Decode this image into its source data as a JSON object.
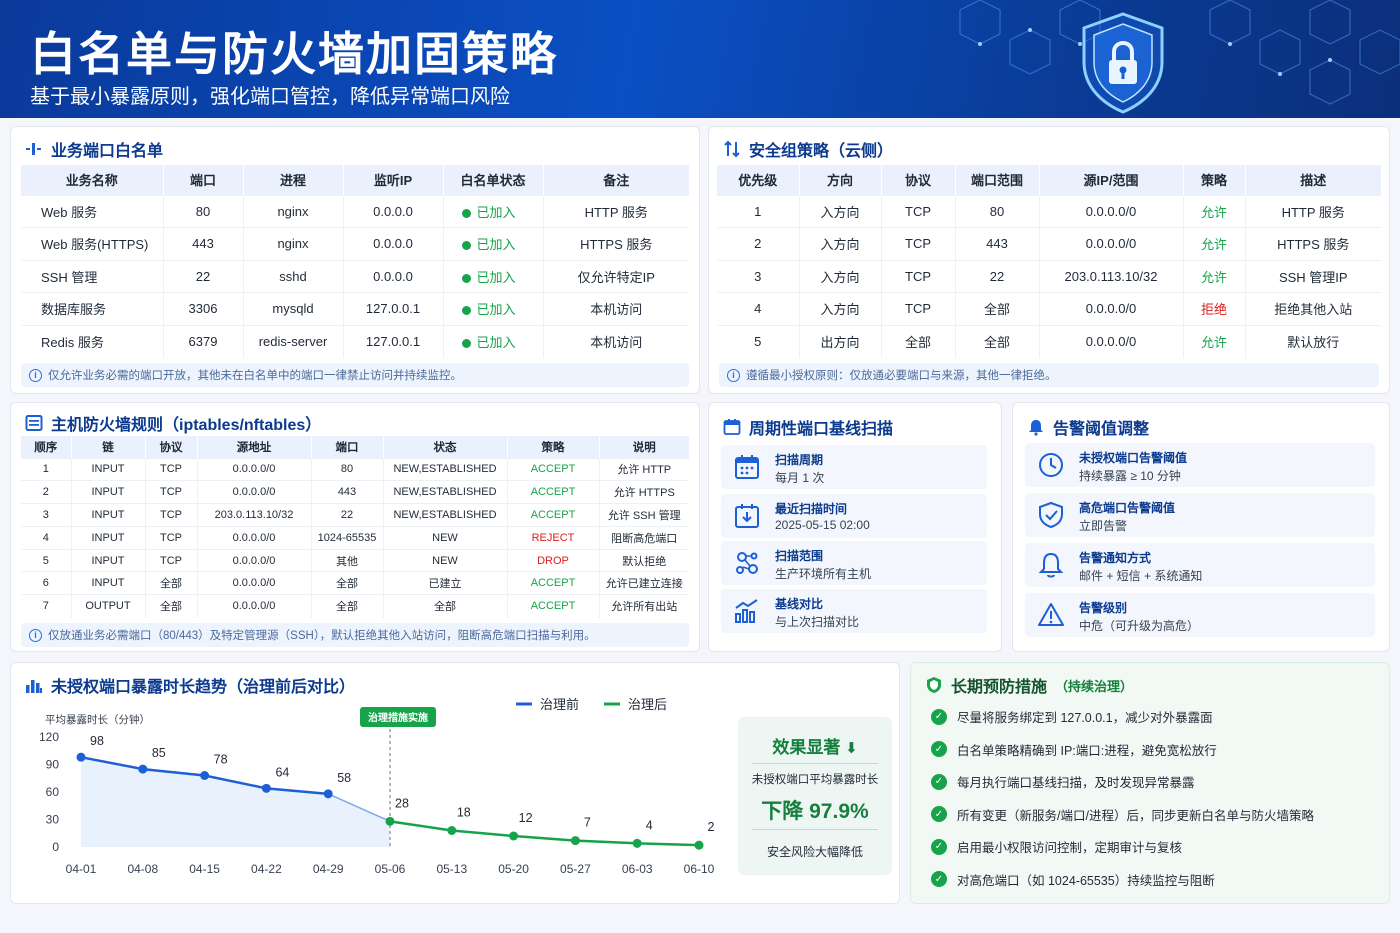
{
  "header": {
    "title": "白名单与防火墙加固策略",
    "subtitle": "基于最小暴露原则，强化端口管控，降低异常端口风险"
  },
  "whitelist": {
    "title": "业务端口白名单",
    "columns": [
      "业务名称",
      "端口",
      "进程",
      "监听IP",
      "白名单状态",
      "备注"
    ],
    "rows": [
      [
        "Web 服务",
        "80",
        "nginx",
        "0.0.0.0",
        "已加入",
        "HTTP 服务"
      ],
      [
        "Web 服务(HTTPS)",
        "443",
        "nginx",
        "0.0.0.0",
        "已加入",
        "HTTPS 服务"
      ],
      [
        "SSH 管理",
        "22",
        "sshd",
        "0.0.0.0",
        "已加入",
        "仅允许特定IP"
      ],
      [
        "数据库服务",
        "3306",
        "mysqld",
        "127.0.0.1",
        "已加入",
        "本机访问"
      ],
      [
        "Redis 服务",
        "6379",
        "redis-server",
        "127.0.0.1",
        "已加入",
        "本机访问"
      ]
    ],
    "note": "仅允许业务必需的端口开放，其他未在白名单中的端口一律禁止访问并持续监控。"
  },
  "secgroup": {
    "title": "安全组策略（云侧）",
    "columns": [
      "优先级",
      "方向",
      "协议",
      "端口范围",
      "源IP/范围",
      "策略",
      "描述"
    ],
    "rows": [
      [
        "1",
        "入方向",
        "TCP",
        "80",
        "0.0.0.0/0",
        "允许",
        "HTTP 服务"
      ],
      [
        "2",
        "入方向",
        "TCP",
        "443",
        "0.0.0.0/0",
        "允许",
        "HTTPS 服务"
      ],
      [
        "3",
        "入方向",
        "TCP",
        "22",
        "203.0.113.10/32",
        "允许",
        "SSH 管理IP"
      ],
      [
        "4",
        "入方向",
        "TCP",
        "全部",
        "0.0.0.0/0",
        "拒绝",
        "拒绝其他入站"
      ],
      [
        "5",
        "出方向",
        "全部",
        "全部",
        "0.0.0.0/0",
        "允许",
        "默认放行"
      ]
    ],
    "deny_value": "拒绝",
    "note": "遵循最小授权原则：仅放通必要端口与来源，其他一律拒绝。"
  },
  "hostfw": {
    "title": "主机防火墙规则（iptables/nftables）",
    "columns": [
      "顺序",
      "链",
      "协议",
      "源地址",
      "端口",
      "状态",
      "策略",
      "说明"
    ],
    "rows": [
      [
        "1",
        "INPUT",
        "TCP",
        "0.0.0.0/0",
        "80",
        "NEW,ESTABLISHED",
        "ACCEPT",
        "允许 HTTP"
      ],
      [
        "2",
        "INPUT",
        "TCP",
        "0.0.0.0/0",
        "443",
        "NEW,ESTABLISHED",
        "ACCEPT",
        "允许 HTTPS"
      ],
      [
        "3",
        "INPUT",
        "TCP",
        "203.0.113.10/32",
        "22",
        "NEW,ESTABLISHED",
        "ACCEPT",
        "允许 SSH 管理"
      ],
      [
        "4",
        "INPUT",
        "TCP",
        "0.0.0.0/0",
        "1024-65535",
        "NEW",
        "REJECT",
        "阻断高危端口"
      ],
      [
        "5",
        "INPUT",
        "TCP",
        "0.0.0.0/0",
        "其他",
        "NEW",
        "DROP",
        "默认拒绝"
      ],
      [
        "6",
        "INPUT",
        "全部",
        "0.0.0.0/0",
        "全部",
        "已建立",
        "ACCEPT",
        "允许已建立连接"
      ],
      [
        "7",
        "OUTPUT",
        "全部",
        "0.0.0.0/0",
        "全部",
        "全部",
        "ACCEPT",
        "允许所有出站"
      ]
    ],
    "note": "仅放通业务必需端口（80/443）及特定管理源（SSH），默认拒绝其他入站访问，阻断高危端口扫描与利用。"
  },
  "scan": {
    "title": "周期性端口基线扫描",
    "items": [
      {
        "label": "扫描周期",
        "value": "每月 1 次",
        "icon": "calendar-icon"
      },
      {
        "label": "最近扫描时间",
        "value": "2025-05-15 02:00",
        "icon": "calendar-clock-icon"
      },
      {
        "label": "扫描范围",
        "value": "生产环境所有主机",
        "icon": "network-icon"
      },
      {
        "label": "基线对比",
        "value": "与上次扫描对比",
        "icon": "bar-chart-icon"
      }
    ]
  },
  "alert": {
    "title": "告警阈值调整",
    "items": [
      {
        "label": "未授权端口告警阈值",
        "value": "持续暴露 ≥ 10 分钟",
        "icon": "clock-icon"
      },
      {
        "label": "高危端口告警阈值",
        "value": "立即告警",
        "icon": "shield-check-icon"
      },
      {
        "label": "告警通知方式",
        "value": "邮件 + 短信 + 系统通知",
        "icon": "bell-icon"
      },
      {
        "label": "告警级别",
        "value": "中危（可升级为高危）",
        "icon": "warning-icon"
      }
    ]
  },
  "trend": {
    "title": "未授权端口暴露时长趋势（治理前后对比）",
    "marker_label": "治理措施实施"
  },
  "chart_data": {
    "type": "line",
    "title": "未授权端口暴露时长趋势（治理前后对比）",
    "ylabel": "平均暴露时长（分钟）",
    "xlabel": "",
    "x": [
      "04-01",
      "04-08",
      "04-15",
      "04-22",
      "04-29",
      "05-06",
      "05-13",
      "05-20",
      "05-27",
      "06-03",
      "06-10"
    ],
    "ylim": [
      0,
      120
    ],
    "yticks": [
      0,
      30,
      60,
      90,
      120
    ],
    "series": [
      {
        "name": "治理前",
        "color": "#1f5fd6",
        "points": [
          [
            "04-01",
            98
          ],
          [
            "04-08",
            85
          ],
          [
            "04-15",
            78
          ],
          [
            "04-22",
            64
          ],
          [
            "04-29",
            58
          ]
        ]
      },
      {
        "name": "治理后",
        "color": "#16a34a",
        "points": [
          [
            "05-06",
            28
          ],
          [
            "05-13",
            18
          ],
          [
            "05-20",
            12
          ],
          [
            "05-27",
            7
          ],
          [
            "06-03",
            4
          ],
          [
            "06-10",
            2
          ]
        ]
      }
    ],
    "annotation": {
      "x": "05-06",
      "text": "治理措施实施"
    },
    "legend": "top"
  },
  "effect": {
    "title": "效果显著",
    "desc": "未授权端口平均暴露时长",
    "value": "下降 97.9%",
    "footer": "安全风险大幅降低"
  },
  "prevent": {
    "title": "长期预防措施",
    "subtitle": "（持续治理）",
    "items": [
      "尽量将服务绑定到 127.0.0.1，减少对外暴露面",
      "白名单策略精确到 IP:端口:进程，避免宽松放行",
      "每月执行端口基线扫描，及时发现异常暴露",
      "所有变更（新服务/端口/进程）后，同步更新白名单与防火墙策略",
      "启用最小权限访问控制，定期审计与复核",
      "对高危端口（如 1024-65535）持续监控与阻断"
    ]
  },
  "colors": {
    "brand": "#0b3a8f",
    "accept": "#16a34a",
    "reject": "#e11d1d"
  }
}
